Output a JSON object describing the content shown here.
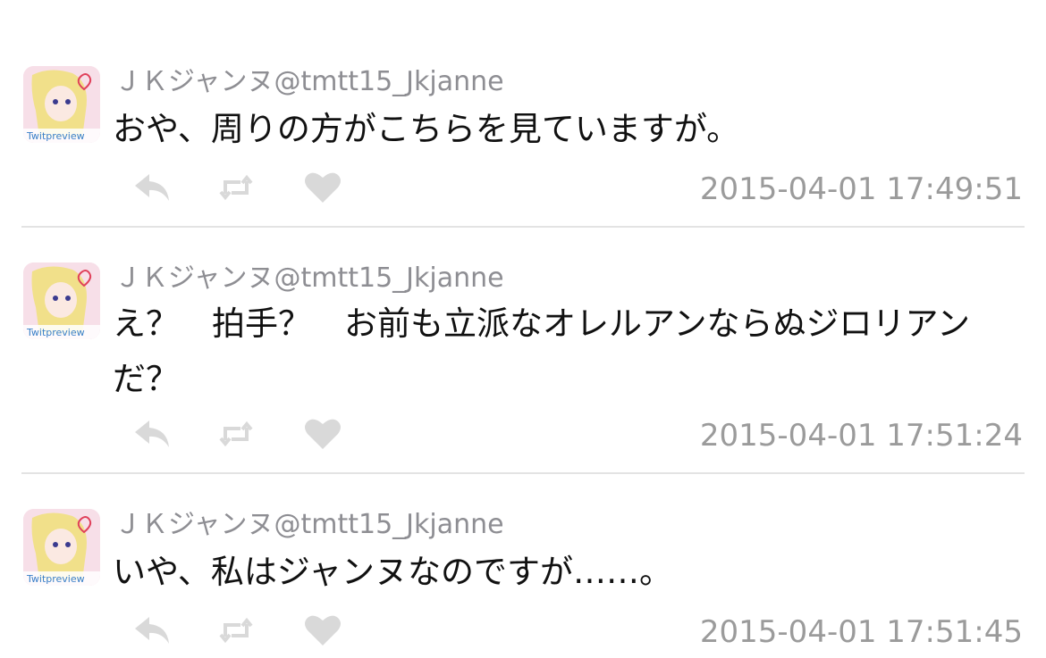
{
  "tweets": [
    {
      "name": "ＪＫジャンヌ",
      "handle": "@tmtt15_Jkjanne",
      "text": "おや、周りの方がこちらを見ていますが。",
      "time": "2015-04-01 17:49:51"
    },
    {
      "name": "ＪＫジャンヌ",
      "handle": "@tmtt15_Jkjanne",
      "text": "え？　拍手？　お前も立派なオレルアンならぬジロリアンだ？",
      "time": "2015-04-01 17:51:24"
    },
    {
      "name": "ＪＫジャンヌ",
      "handle": "@tmtt15_Jkjanne",
      "text": "いや、私はジャンヌなのですが……。",
      "time": "2015-04-01 17:51:45"
    }
  ],
  "avatar_label": "Twitpreview",
  "action_icons": [
    "reply-icon",
    "retweet-icon",
    "like-icon"
  ],
  "colors": {
    "meta_text": "#8e8e93",
    "body_text": "#111111",
    "icon": "#d9d9d9",
    "divider": "#e3e3e3",
    "timestamp": "#9b9b9b"
  }
}
